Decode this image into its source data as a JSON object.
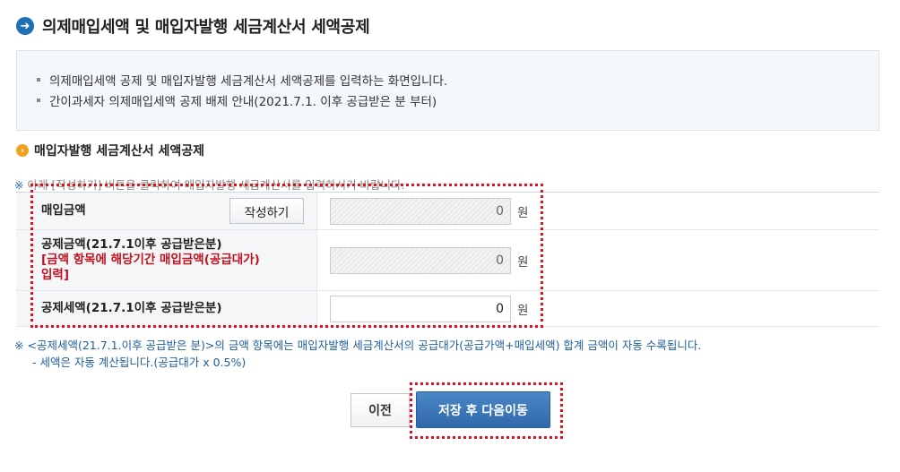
{
  "header": {
    "title": "의제매입세액 및 매입자발행 세금계산서 세액공제",
    "icon": "arrow-right-circle-icon"
  },
  "info": {
    "lines": [
      "의제매입세액 공제 및 매입자발행 세금계산서 세액공제를 입력하는 화면입니다.",
      "간이과세자 의제매입세액 공제 배제 안내(2021.7.1. 이후 공급받은 분 부터)"
    ]
  },
  "section": {
    "title": "매입자발행 세금계산서 세액공제",
    "icon": "chevron-circle-icon"
  },
  "notice_top": {
    "mark": "※",
    "text": "아래 [작성하기] 버튼을 클릭하여 매입자발행 세금계산서를 입력하시기 바랍니다."
  },
  "rows": [
    {
      "label": "매입금액",
      "button": "작성하기",
      "value": "0",
      "unit": "원",
      "editable": false
    },
    {
      "label": "공제금액(21.7.1이후 공급받은분)",
      "note": "[금액 항목에 해당기간 매입금액(공급대가) 입력]",
      "value": "0",
      "unit": "원",
      "editable": false
    },
    {
      "label": "공제세액(21.7.1이후 공급받은분)",
      "value": "0",
      "unit": "원",
      "editable": true
    }
  ],
  "notice_bottom": {
    "mark": "※",
    "line1": "<공제세액(21.7.1.이후 공급받은 분)>의 금액 항목에는 매입자발행 세금계산서의 공급대가(공급가액+매입세액) 합계 금액이 자동 수록됩니다.",
    "line2": "- 세액은 자동 계산됩니다.(공급대가 x 0.5%)"
  },
  "buttons": {
    "prev": "이전",
    "next": "저장 후 다음이동"
  },
  "colors": {
    "accent": "#2f69aa",
    "warning_text": "#c0121e",
    "highlight_dash": "#e0101e"
  }
}
